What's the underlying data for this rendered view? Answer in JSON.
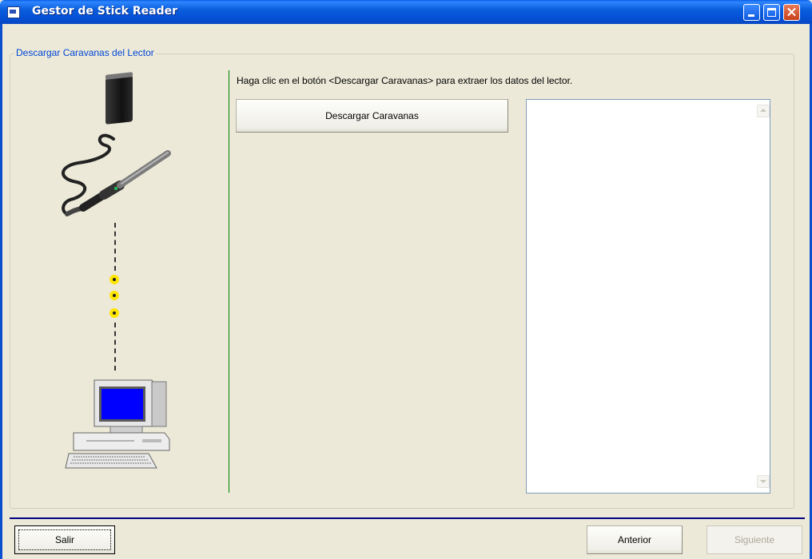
{
  "window": {
    "title": "Gestor de Stick Reader",
    "icons": [
      "app-icon",
      "minimize-icon",
      "maximize-icon",
      "close-icon"
    ]
  },
  "group": {
    "label": "Descargar Caravanas del Lector"
  },
  "main": {
    "instruction": "Haga clic en el botón <Descargar Caravanas> para extraer los datos del lector.",
    "download_button": "Descargar Caravanas",
    "list_items": []
  },
  "footer": {
    "exit_button": "Salir",
    "previous_button": "Anterior",
    "next_button": "Siguiente"
  },
  "colors": {
    "titlebar": "#0A5EDC",
    "group_label": "#0046D5",
    "divider": "#008000",
    "separator": "#000080",
    "dots": "#FFE600",
    "disabled_text": "#ACA899"
  }
}
